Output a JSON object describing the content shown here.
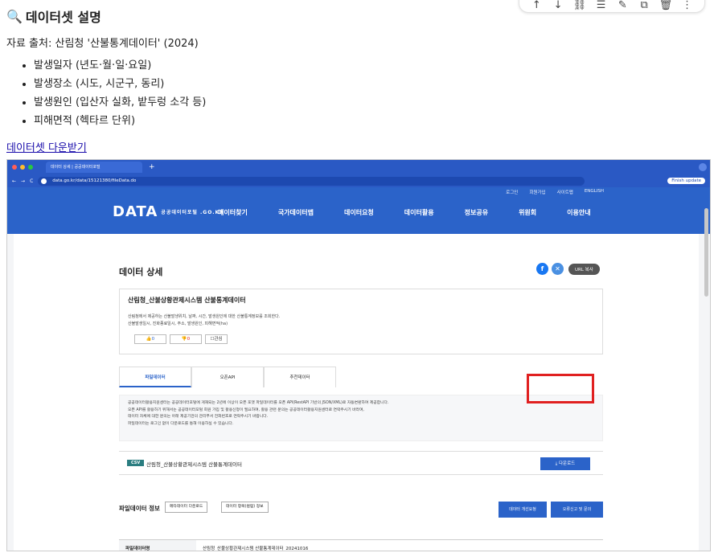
{
  "toolbar": {
    "icons": [
      "arrow-up-icon",
      "arrow-down-icon",
      "link-icon",
      "comment-icon",
      "pencil-icon",
      "crop-icon",
      "trash-icon",
      "more-icon"
    ],
    "glyphs": [
      "↑",
      "↓",
      "⛓",
      "☰",
      "✎",
      "⧉",
      "🗑",
      "⋮"
    ]
  },
  "heading": {
    "icon": "🔍",
    "title": "데이터셋 설명"
  },
  "source": "자료 출처: 산림청 '산불통계데이터' (2024)",
  "bullets": [
    "발생일자 (년도·월·일·요일)",
    "발생장소 (시도, 시군구, 동리)",
    "발생원인 (입산자 실화, 밭두렁 소각 등)",
    "피해면적 (헥타르 단위)"
  ],
  "download_link": "데이터셋 다운받기",
  "browser": {
    "tab_title": "데이터 상세 | 공공데이터포털",
    "url": "data.go.kr/data/15121380/fileData.do",
    "finish_update": "Finish update",
    "site": {
      "top_links": [
        "로그인",
        "회원가입",
        "사이트맵",
        "ENGLISH"
      ],
      "logo_main": "DATA",
      "logo_sub": "공공데이터포털 .GO.KR",
      "nav": [
        "데이터찾기",
        "국가데이터맵",
        "데이터요청",
        "데이터활용",
        "정보공유",
        "위원회",
        "이용안내"
      ]
    },
    "page_title": "데이터 상세",
    "url_copy": "URL 복사",
    "dataset_title": "산림청_산불상황관제시스템 산불통계데이터",
    "dataset_desc1": "산림청에서 제공하는 산불발생위치, 날짜, 시간, 발생원인에 대한 산불통계정보를 조회한다.",
    "dataset_desc2": "산불발생일시, 진화종료일시, 주소, 발생원인, 피해면적(ha)",
    "likes": "0",
    "dislikes": "0",
    "interest": "관심",
    "tabs": [
      "파일데이터",
      "오픈API",
      "추천데이터"
    ],
    "notice": [
      "공공데이터활용지원센터는 공공데이터포털에 게재되는 2년에 이상이 오픈 포맷 파일데이터를 오픈 API(RestAPI 기반의 JSON/XML)로 자동변환하여 제공합니다.",
      "오픈 API를 활용하기 위해서는 공공데이터포털 회원 가입 및 활용신청이 필요하며, 활용 관련 문의는 공공데이터활용지원센터로 연락주시기 바라며,",
      "데이터 자체에 대한 문의는 아래 제공기관의 관리부서 전화번호로 연락주시기 바랍니다.",
      "파일데이터는 로그인 없이 다운로드를 통해 이용하실 수 있습니다."
    ],
    "file_format": "CSV",
    "file_name": "산림청_산불상황관제시스템 산불통계데이터",
    "download_btn": "다운로드",
    "file_info_title": "파일데이터 정보",
    "meta_download": "메타데이터 다운로드",
    "item_info": "데이터 항목(컬럼) 정보",
    "improve_req": "데이터 개선요청",
    "error_report": "오류신고 및 문의",
    "table_key": "파일데이터명",
    "table_val": "산림청_산불상황관제시스템 산불통계데이터_20241016"
  }
}
